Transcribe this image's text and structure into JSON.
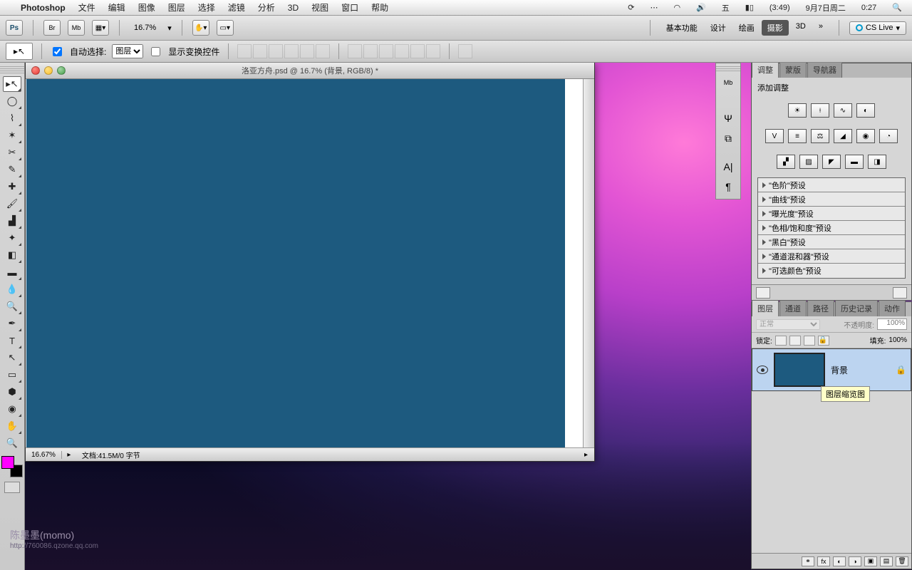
{
  "menubar": {
    "app": "Photoshop",
    "items": [
      "文件",
      "编辑",
      "图像",
      "图层",
      "选择",
      "滤镜",
      "分析",
      "3D",
      "视图",
      "窗口",
      "帮助"
    ],
    "battery": "(3:49)",
    "date": "9月7日周二",
    "time": "0:27"
  },
  "apptoolbar": {
    "zoom": "16.7%",
    "workspaces": [
      "基本功能",
      "设计",
      "绘画",
      "摄影",
      "3D"
    ],
    "ws_active_index": 3,
    "more": "»",
    "cslive": "CS Live"
  },
  "optionsbar": {
    "auto_select_label": "自动选择:",
    "auto_select_value": "图层",
    "show_transform_label": "显示变换控件"
  },
  "document": {
    "title": "洛亚方舟.psd @ 16.7% (背景, RGB/8) *",
    "zoom": "16.67%",
    "docinfo": "文档:41.5M/0 字节"
  },
  "panels": {
    "adj_tabs": [
      "调整",
      "蒙版",
      "导航器"
    ],
    "adj_title": "添加调整",
    "presets": [
      "\"色阶\"预设",
      "\"曲线\"预设",
      "\"曝光度\"预设",
      "\"色相/饱和度\"预设",
      "\"黑白\"预设",
      "\"通道混和器\"预设",
      "\"可选颜色\"预设"
    ],
    "layer_tabs": [
      "图层",
      "通道",
      "路径",
      "历史记录",
      "动作"
    ],
    "blend_mode": "正常",
    "opacity_label": "不透明度:",
    "opacity_value": "100%",
    "lock_label": "锁定:",
    "fill_label": "填充:",
    "fill_value": "100%",
    "layer_name": "背景",
    "tooltip": "图层缩览图"
  },
  "watermark": {
    "name": "陈墨墨(momo)",
    "url": "http://760086.qzone.qq.com"
  }
}
